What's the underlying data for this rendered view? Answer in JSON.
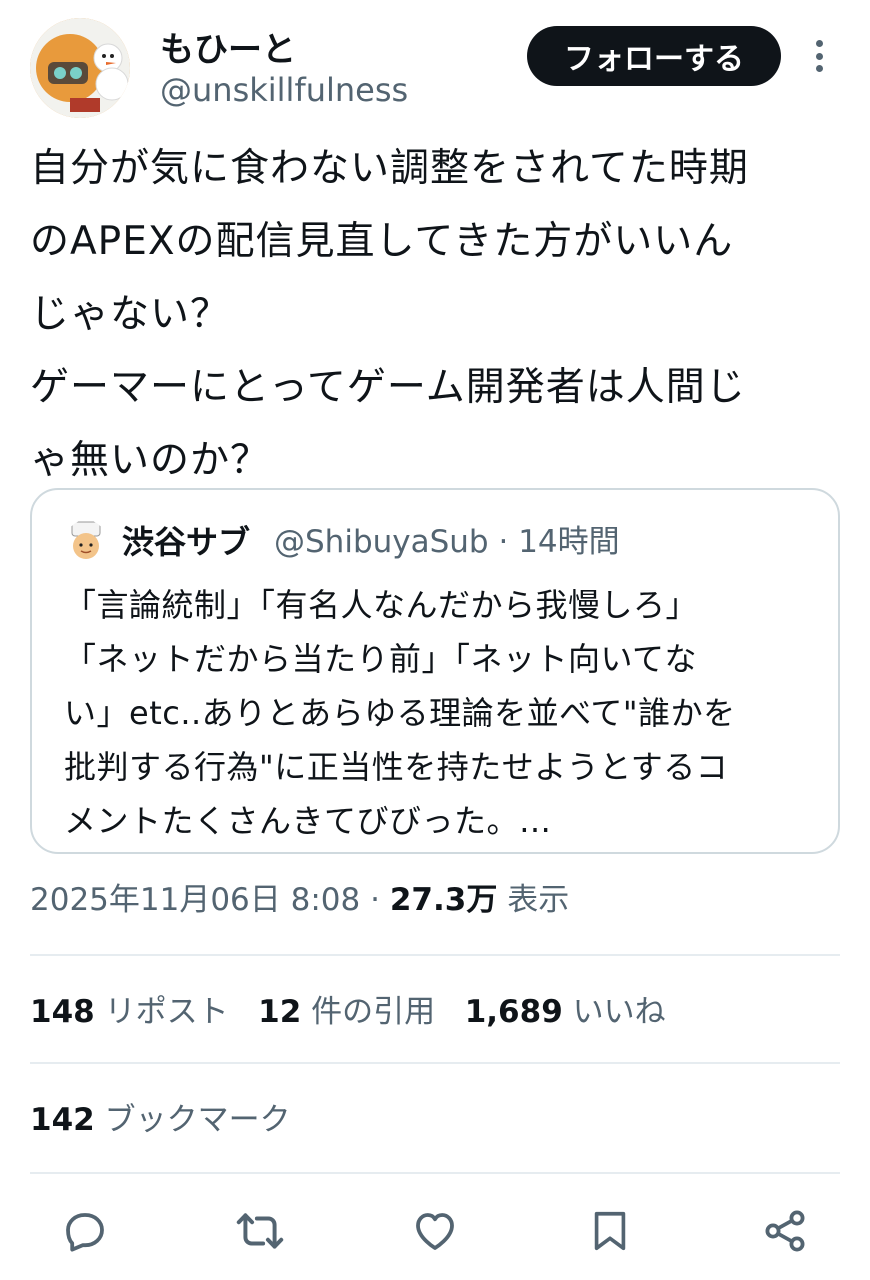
{
  "author": {
    "display_name": "もひーと",
    "handle": "@unskillfulness"
  },
  "follow_button": "フォローする",
  "tweet_text": "自分が気に食わない調整をされてた時期\nのAPEXの配信見直してきた方がいいん\nじゃない？\nゲーマーにとってゲーム開発者は人間じ\nゃ無いのか？",
  "quote": {
    "display_name": "渋谷サブ",
    "handle": "@ShibuyaSub",
    "separator": "·",
    "time": "14時間",
    "text": "「言論統制」「有名人なんだから我慢しろ」\n「ネットだから当たり前」「ネット向いてな\nい」etc..ありとあらゆる理論を並べて\"誰かを\n批判する行為\"に正当性を持たせようとするコ\nメントたくさんきてびびった。…"
  },
  "timestamp": "2025年11月06日 8:08",
  "dot": "·",
  "views": {
    "count": "27.3万",
    "label": "表示"
  },
  "stats": {
    "reposts": {
      "count": "148",
      "label": "リポスト"
    },
    "quotes": {
      "count": "12",
      "label": "件の引用"
    },
    "likes": {
      "count": "1,689",
      "label": "いいね"
    },
    "bookmarks": {
      "count": "142",
      "label": "ブックマーク"
    }
  },
  "icons": {
    "reply": "reply-icon",
    "repost": "repost-icon",
    "like": "heart-icon",
    "bookmark": "bookmark-icon",
    "share": "share-icon",
    "more": "more-vertical-icon"
  },
  "colors": {
    "text": "#0f1419",
    "secondary": "#536471",
    "border": "#cfd9de",
    "divider": "#e6ecf0",
    "button_bg": "#0f1419"
  }
}
